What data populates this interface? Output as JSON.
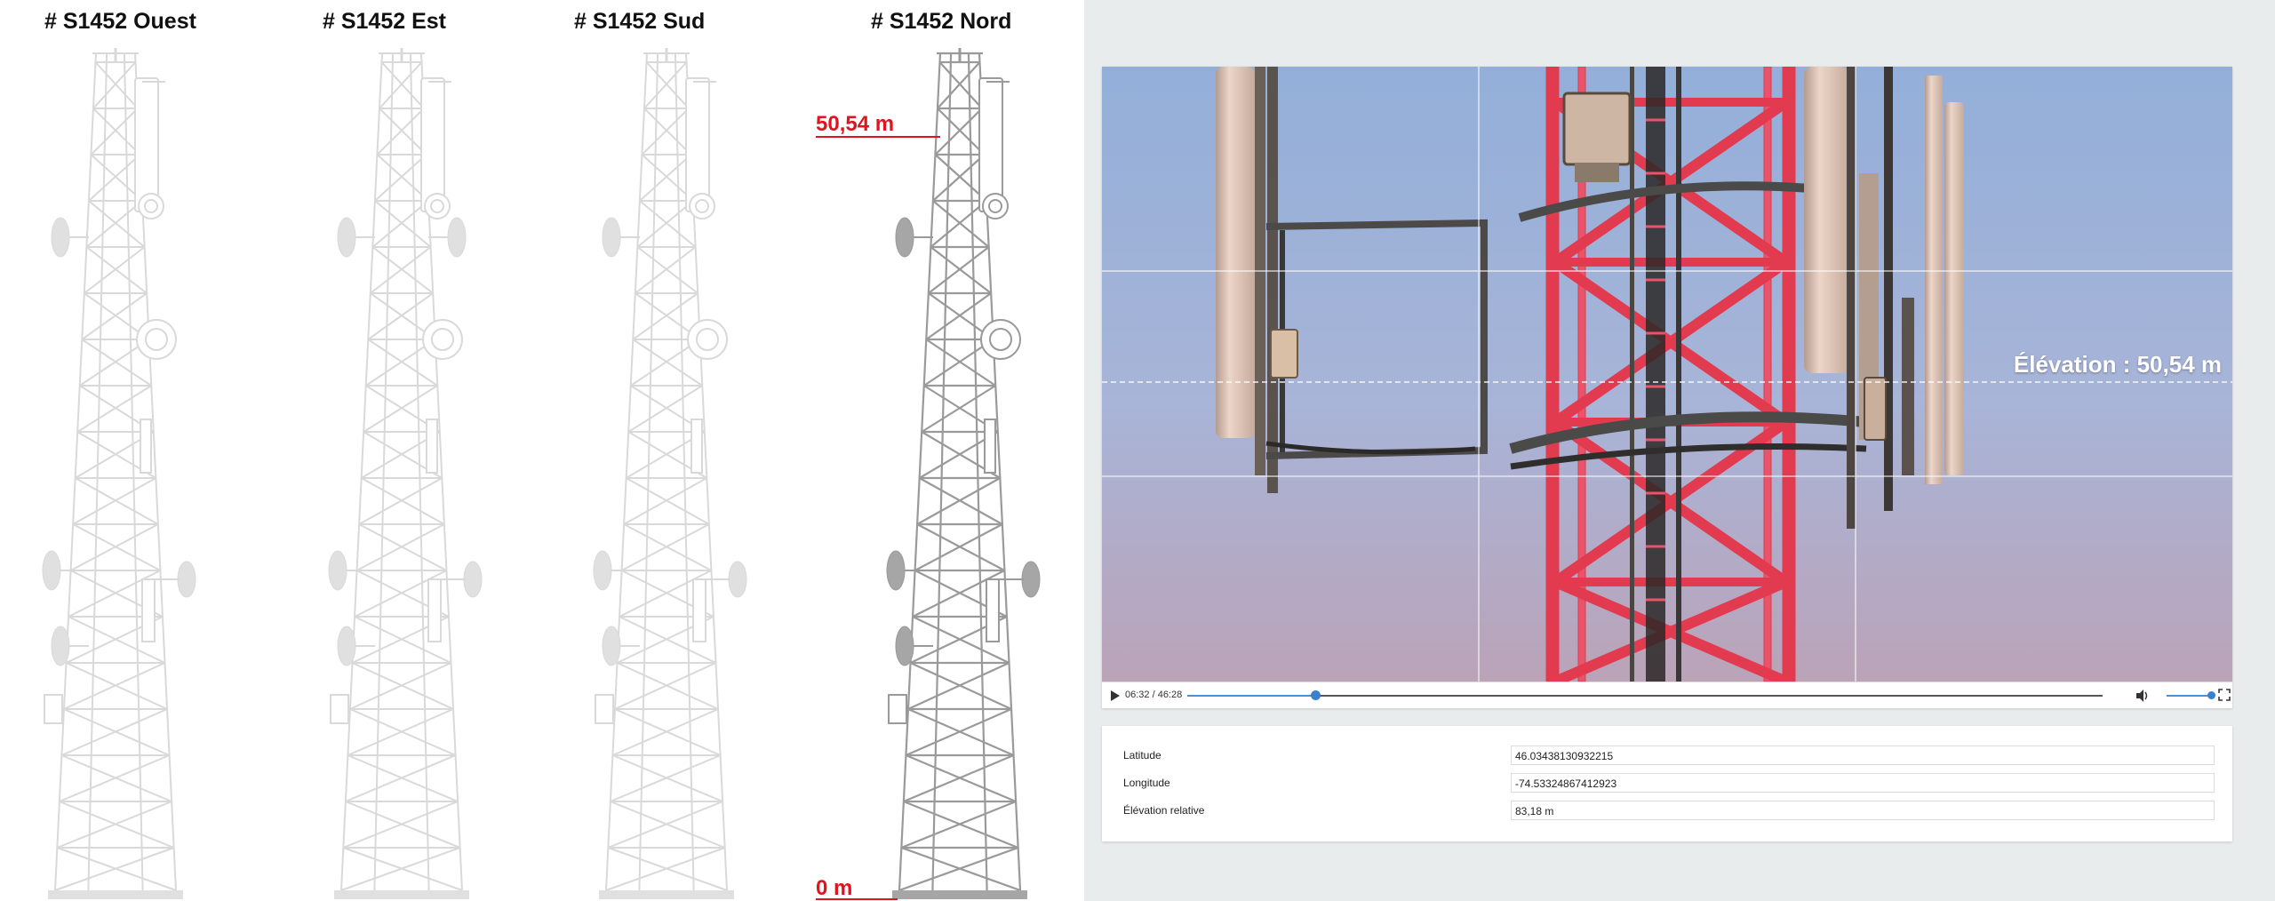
{
  "towers": [
    {
      "title": "# S1452 Ouest",
      "active": false
    },
    {
      "title": "# S1452 Est",
      "active": false
    },
    {
      "title": "# S1452 Sud",
      "active": false
    },
    {
      "title": "# S1452  Nord",
      "active": true
    }
  ],
  "height_markers": {
    "top_label": "50,54 m",
    "bottom_label": "0 m",
    "color": "#e0141e"
  },
  "video": {
    "elevation_overlay": "Élévation : 50,54 m",
    "time": "06:32 / 46:28",
    "progress_fraction": 0.14,
    "volume_fraction": 0.92,
    "controls": {
      "play_icon": "play-icon",
      "volume_icon": "volume-icon",
      "fullscreen_icon": "fullscreen-icon"
    }
  },
  "info": {
    "rows": [
      {
        "label": "Latitude",
        "value": "46.03438130932215"
      },
      {
        "label": "Longitude",
        "value": "-74.53324867412923"
      },
      {
        "label": "Élévation relative",
        "value": "83,18 m"
      }
    ]
  },
  "colors": {
    "accent": "#4a90d9",
    "tower_red": "#e23a4e",
    "sky_top": "#93afd9",
    "sky_bottom": "#b9a4bb",
    "panel_bg": "#e9eced"
  }
}
